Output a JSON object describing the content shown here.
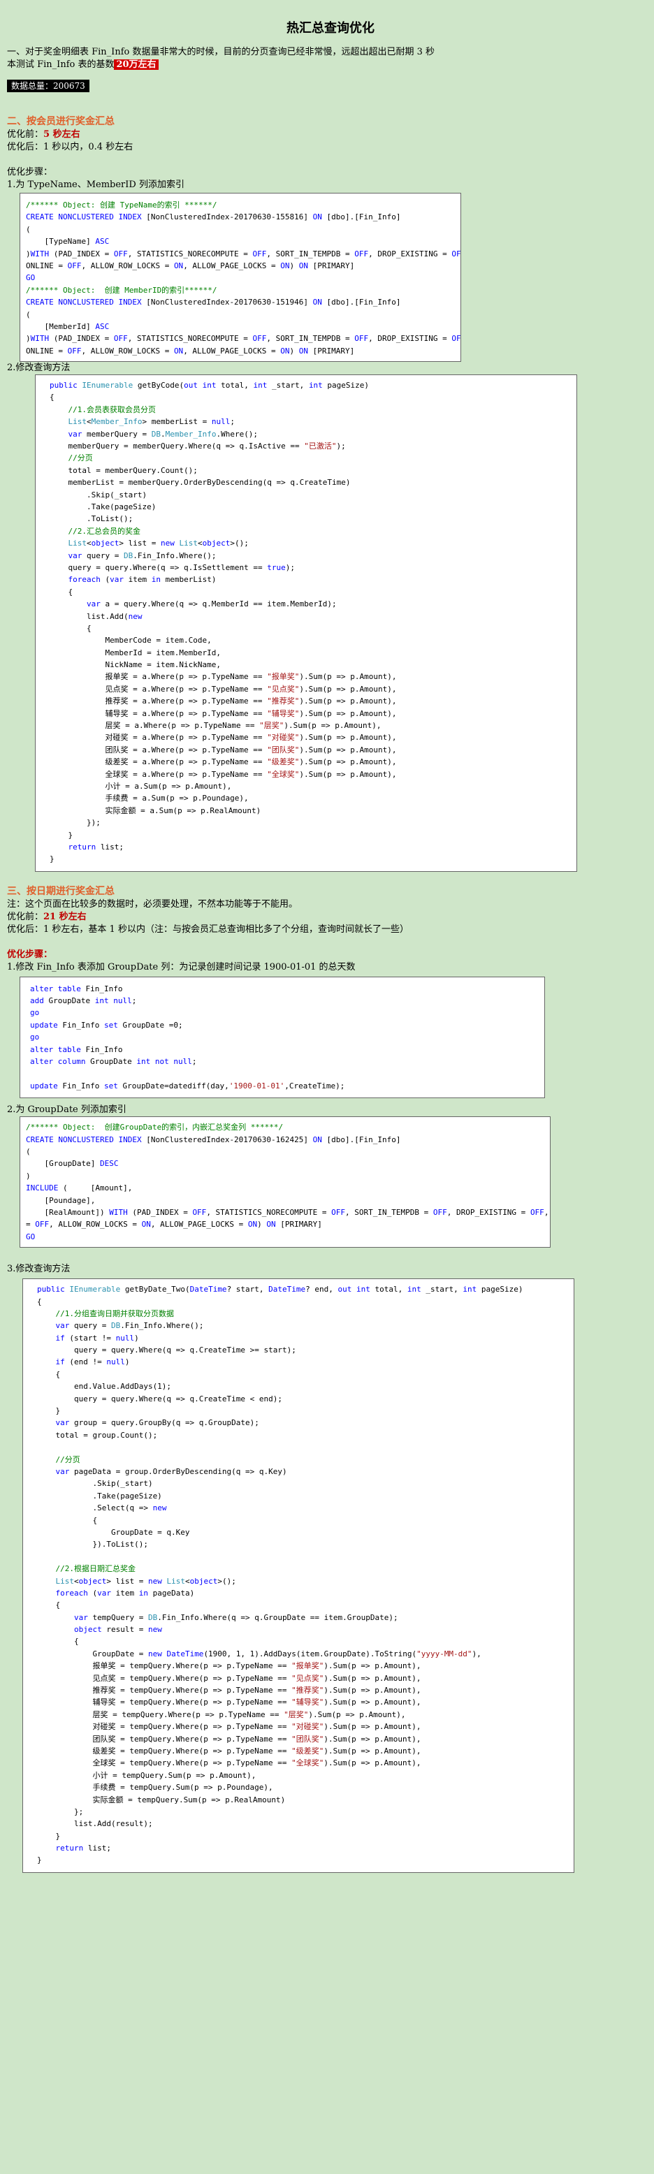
{
  "title": "热汇总查询优化",
  "intro": {
    "line1": "一、对于奖金明细表 Fin_Info 数据量非常大的时候，目前的分页查询已经非常慢，远超出超出已耐期 3 秒",
    "line2_prefix": "本测试 Fin_Info 表的基数",
    "line2_highlight": "20万左右",
    "data_total_label": "数据总量：200673"
  },
  "section2": {
    "heading": "二、按会员进行奖金汇总",
    "before_label": "优化前：",
    "before_value": "5 秒左右",
    "after": "优化后：1 秒以内，0.4 秒左右",
    "steps_label": "优化步骤：",
    "step1": "1.为 TypeName、MemberID 列添加索引",
    "step2": "2.修改查询方法"
  },
  "code1": [
    "/****** Object: 创建 TypeName的索引 ******/",
    "CREATE NONCLUSTERED INDEX [NonClusteredIndex-20170630-155816] ON [dbo].[Fin_Info]",
    "(",
    "    [TypeName] ASC",
    ")WITH (PAD_INDEX = OFF, STATISTICS_NORECOMPUTE = OFF, SORT_IN_TEMPDB = OFF, DROP_EXISTING = OFF,",
    "ONLINE = OFF, ALLOW_ROW_LOCKS = ON, ALLOW_PAGE_LOCKS = ON) ON [PRIMARY]",
    "GO",
    "/****** Object:  创建 MemberID的索引******/",
    "CREATE NONCLUSTERED INDEX [NonClusteredIndex-20170630-151946] ON [dbo].[Fin_Info]",
    "(",
    "    [MemberId] ASC",
    ")WITH (PAD_INDEX = OFF, STATISTICS_NORECOMPUTE = OFF, SORT_IN_TEMPDB = OFF, DROP_EXISTING = OFF,",
    "ONLINE = OFF, ALLOW_ROW_LOCKS = ON, ALLOW_PAGE_LOCKS = ON) ON [PRIMARY]"
  ],
  "code2": [
    "public IEnumerable getByCode(out int total, int _start, int pageSize)",
    "{",
    "    //1.会员表获取会员分页",
    "    List<Member_Info> memberList = null;",
    "    var memberQuery = DB.Member_Info.Where();",
    "    memberQuery = memberQuery.Where(q => q.IsActive == \"已激活\");",
    "    //分页",
    "    total = memberQuery.Count();",
    "    memberList = memberQuery.OrderByDescending(q => q.CreateTime)",
    "        .Skip(_start)",
    "        .Take(pageSize)",
    "        .ToList();",
    "    //2.汇总会员的奖金",
    "    List<object> list = new List<object>();",
    "    var query = DB.Fin_Info.Where();",
    "    query = query.Where(q => q.IsSettlement == true);",
    "    foreach (var item in memberList)",
    "    {",
    "        var a = query.Where(q => q.MemberId == item.MemberId);",
    "        list.Add(new",
    "        {",
    "            MemberCode = item.Code,",
    "            MemberId = item.MemberId,",
    "            NickName = item.NickName,",
    "            报单奖 = a.Where(p => p.TypeName == \"报单奖\").Sum(p => p.Amount),",
    "            见点奖 = a.Where(p => p.TypeName == \"见点奖\").Sum(p => p.Amount),",
    "            推荐奖 = a.Where(p => p.TypeName == \"推荐奖\").Sum(p => p.Amount),",
    "            辅导奖 = a.Where(p => p.TypeName == \"辅导奖\").Sum(p => p.Amount),",
    "            层奖 = a.Where(p => p.TypeName == \"层奖\").Sum(p => p.Amount),",
    "            对碰奖 = a.Where(p => p.TypeName == \"对碰奖\").Sum(p => p.Amount),",
    "            团队奖 = a.Where(p => p.TypeName == \"团队奖\").Sum(p => p.Amount),",
    "            级差奖 = a.Where(p => p.TypeName == \"级差奖\").Sum(p => p.Amount),",
    "            全球奖 = a.Where(p => p.TypeName == \"全球奖\").Sum(p => p.Amount),",
    "            小计 = a.Sum(p => p.Amount),",
    "            手续费 = a.Sum(p => p.Poundage),",
    "            实际金额 = a.Sum(p => p.RealAmount)",
    "        });",
    "    }",
    "    return list;",
    "}"
  ],
  "section3": {
    "heading": "三、按日期进行奖金汇总",
    "note": "注：这个页面在比较多的数据时，必须要处理，不然本功能等于不能用。",
    "before_label": "优化前：",
    "before_value": "21 秒左右",
    "after": "优化后：1 秒左右，基本 1 秒以内（注：与按会员汇总查询相比多了个分组，查询时间就长了一些）",
    "steps_label": "优化步骤：",
    "step1": "1.修改 Fin_Info 表添加 GroupDate 列：为记录创建时间记录 1900-01-01 的总天数",
    "step2": "2.为 GroupDate 列添加索引",
    "step3": "3.修改查询方法"
  },
  "code3": [
    "alter table Fin_Info",
    "add GroupDate int null;",
    "go",
    "update Fin_Info set GroupDate =0;",
    "go",
    "alter table Fin_Info",
    "alter column GroupDate int not null;",
    "",
    "update Fin_Info set GroupDate=datediff(day,'1900-01-01',CreateTime);"
  ],
  "code4": [
    "/****** Object:  创建GroupDate的索引，内嵌汇总奖金列 ******/",
    "CREATE NONCLUSTERED INDEX [NonClusteredIndex-20170630-162425] ON [dbo].[Fin_Info]",
    "(",
    "    [GroupDate] DESC",
    ")",
    "INCLUDE (     [Amount],",
    "    [Poundage],",
    "    [RealAmount]) WITH (PAD_INDEX = OFF, STATISTICS_NORECOMPUTE = OFF, SORT_IN_TEMPDB = OFF, DROP_EXISTING = OFF, ONLINE",
    "= OFF, ALLOW_ROW_LOCKS = ON, ALLOW_PAGE_LOCKS = ON) ON [PRIMARY]",
    "GO"
  ],
  "code5": [
    "public IEnumerable getByDate_Two(DateTime? start, DateTime? end, out int total, int _start, int pageSize)",
    "{",
    "    //1.分组查询日期并获取分页数据",
    "    var query = DB.Fin_Info.Where();",
    "    if (start != null)",
    "        query = query.Where(q => q.CreateTime >= start);",
    "    if (end != null)",
    "    {",
    "        end.Value.AddDays(1);",
    "        query = query.Where(q => q.CreateTime < end);",
    "    }",
    "    var group = query.GroupBy(q => q.GroupDate);",
    "    total = group.Count();",
    "",
    "    //分页",
    "    var pageData = group.OrderByDescending(q => q.Key)",
    "            .Skip(_start)",
    "            .Take(pageSize)",
    "            .Select(q => new",
    "            {",
    "                GroupDate = q.Key",
    "            }).ToList();",
    "",
    "    //2.根据日期汇总奖金",
    "    List<object> list = new List<object>();",
    "    foreach (var item in pageData)",
    "    {",
    "        var tempQuery = DB.Fin_Info.Where(q => q.GroupDate == item.GroupDate);",
    "        object result = new",
    "        {",
    "            GroupDate = new DateTime(1900, 1, 1).AddDays(item.GroupDate).ToString(\"yyyy-MM-dd\"),",
    "            报单奖 = tempQuery.Where(p => p.TypeName == \"报单奖\").Sum(p => p.Amount),",
    "            见点奖 = tempQuery.Where(p => p.TypeName == \"见点奖\").Sum(p => p.Amount),",
    "            推荐奖 = tempQuery.Where(p => p.TypeName == \"推荐奖\").Sum(p => p.Amount),",
    "            辅导奖 = tempQuery.Where(p => p.TypeName == \"辅导奖\").Sum(p => p.Amount),",
    "            层奖 = tempQuery.Where(p => p.TypeName == \"层奖\").Sum(p => p.Amount),",
    "            对碰奖 = tempQuery.Where(p => p.TypeName == \"对碰奖\").Sum(p => p.Amount),",
    "            团队奖 = tempQuery.Where(p => p.TypeName == \"团队奖\").Sum(p => p.Amount),",
    "            级差奖 = tempQuery.Where(p => p.TypeName == \"级差奖\").Sum(p => p.Amount),",
    "            全球奖 = tempQuery.Where(p => p.TypeName == \"全球奖\").Sum(p => p.Amount),",
    "            小计 = tempQuery.Sum(p => p.Amount),",
    "            手续费 = tempQuery.Sum(p => p.Poundage),",
    "            实际金额 = tempQuery.Sum(p => p.RealAmount)",
    "        };",
    "        list.Add(result);",
    "    }",
    "    return list;",
    "}"
  ]
}
